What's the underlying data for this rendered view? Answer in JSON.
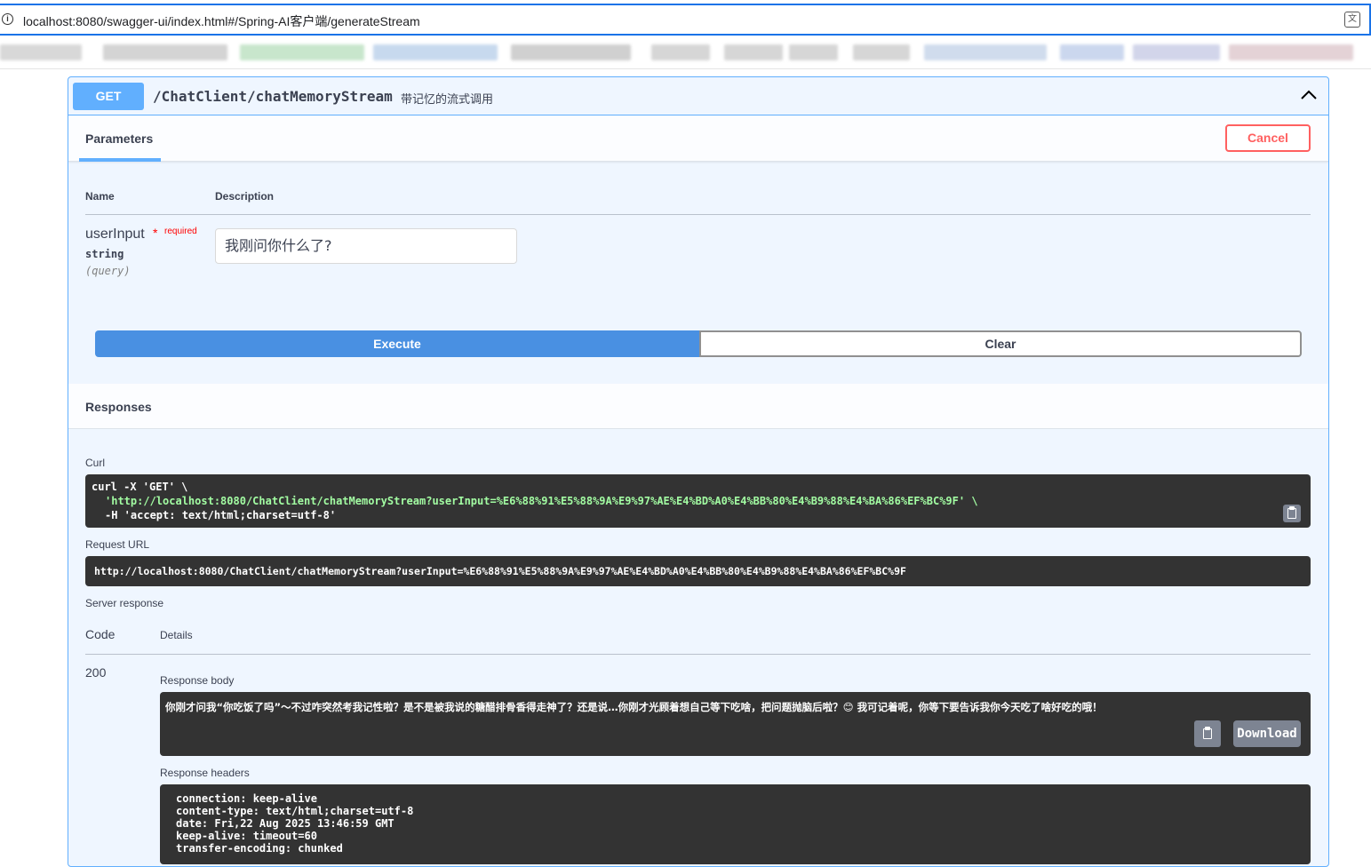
{
  "browser": {
    "url": "localhost:8080/swagger-ui/index.html#/Spring-AI客户端/generateStream",
    "info_icon": "info-icon",
    "translate_icon": "translate-icon"
  },
  "operation": {
    "method": "GET",
    "path": "/ChatClient/chatMemoryStream",
    "summary": "带记忆的流式调用",
    "collapse_icon": "chevron-up-icon"
  },
  "parameters": {
    "tab_label": "Parameters",
    "cancel_label": "Cancel",
    "col_name": "Name",
    "col_description": "Description",
    "items": [
      {
        "name": "userInput",
        "required_star": "*",
        "required_label": "required",
        "type": "string",
        "in": "(query)",
        "value": "我刚问你什么了?"
      }
    ],
    "execute_label": "Execute",
    "clear_label": "Clear"
  },
  "responses": {
    "title": "Responses",
    "curl_label": "Curl",
    "curl_lines": [
      "curl -X 'GET' \\",
      "'http://localhost:8080/ChatClient/chatMemoryStream?userInput=%E6%88%91%E5%88%9A%E9%97%AE%E4%BD%A0%E4%BB%80%E4%B9%88%E4%BA%86%EF%BC%9F' \\",
      "-H 'accept: text/html;charset=utf-8'"
    ],
    "request_url_label": "Request URL",
    "request_url": "http://localhost:8080/ChatClient/chatMemoryStream?userInput=%E6%88%91%E5%88%9A%E9%97%AE%E4%BD%A0%E4%BB%80%E4%B9%88%E4%BA%86%EF%BC%9F",
    "server_response_label": "Server response",
    "code_header": "Code",
    "details_header": "Details",
    "status_code": "200",
    "response_body_label": "Response body",
    "response_body": "你刚才问我“你吃饭了吗”～不过咋突然考我记性啦？是不是被我说的糖醋排骨香得走神了？还是说…你刚才光顾着想自己等下吃啥，把问题抛脑后啦？😊 我可记着呢，你等下要告诉我你今天吃了啥好吃的哦！",
    "download_label": "Download",
    "response_headers_label": "Response headers",
    "headers": [
      "connection: keep-alive",
      "content-type: text/html;charset=utf-8",
      "date: Fri,22 Aug 2025 13:46:59 GMT",
      "keep-alive: timeout=60",
      "transfer-encoding: chunked"
    ]
  }
}
